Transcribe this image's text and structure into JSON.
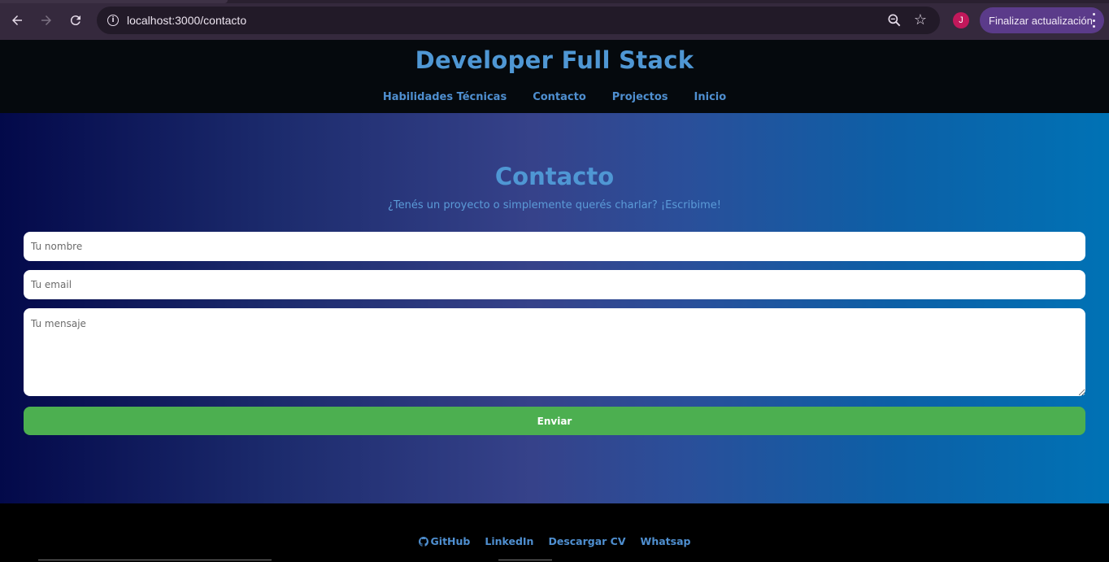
{
  "browser": {
    "url": "localhost:3000/contacto",
    "avatar_letter": "J",
    "update_label": "Finalizar actualización",
    "icons": [
      "back-icon",
      "forward-icon",
      "reload-icon",
      "site-info-icon",
      "zoom-icon",
      "bookmark-star-icon",
      "more-vert-icon"
    ]
  },
  "site": {
    "title": "Developer Full Stack",
    "nav": [
      "Habilidades Técnicas",
      "Contacto",
      "Projectos",
      "Inicio"
    ]
  },
  "contact": {
    "title": "Contacto",
    "subtitle": "¿Tenés un proyecto o simplemente querés charlar? ¡Escribime!",
    "name_placeholder": "Tu nombre",
    "email_placeholder": "Tu email",
    "message_placeholder": "Tu mensaje",
    "submit_label": "Enviar"
  },
  "footer": {
    "links": [
      "GitHub",
      "LinkedIn",
      "Descargar CV",
      "Whatsap"
    ]
  },
  "colors": {
    "accent_blue": "#4f97d4",
    "button_green": "#4caf50",
    "update_purple": "#5b3b8a",
    "avatar_pink": "#c2185b"
  }
}
